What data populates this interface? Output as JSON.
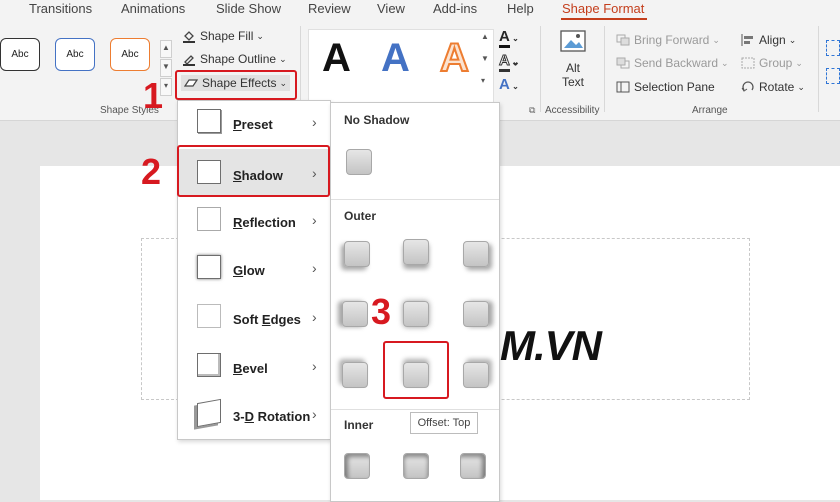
{
  "tabs": [
    "Transitions",
    "Animations",
    "Slide Show",
    "Review",
    "View",
    "Add-ins",
    "Help",
    "Shape Format"
  ],
  "active_tab": "Shape Format",
  "shape_styles": {
    "swatches": [
      "Abc",
      "Abc",
      "Abc"
    ],
    "swatch_colors": [
      "#333333",
      "#4472c4",
      "#ed7d31"
    ],
    "fill_label": "Shape Fill",
    "outline_label": "Shape Outline",
    "effects_label": "Shape Effects",
    "group_label": "Shape Styles"
  },
  "wordart": {
    "letter": "A",
    "colors": [
      "#111111",
      "#4472c4",
      "#ed7d31"
    ]
  },
  "accessibility": {
    "alt_text_line1": "Alt",
    "alt_text_line2": "Text",
    "group_label": "Accessibility"
  },
  "arrange": {
    "bring_forward": "Bring Forward",
    "send_backward": "Send Backward",
    "selection_pane": "Selection Pane",
    "align": "Align",
    "group": "Group",
    "rotate": "Rotate",
    "group_label": "Arrange"
  },
  "callouts": [
    "1",
    "2",
    "3"
  ],
  "effects_menu": [
    {
      "label": "Preset",
      "accel": "P",
      "rest": "reset"
    },
    {
      "label": "Shadow",
      "accel": "S",
      "rest": "hadow"
    },
    {
      "label": "Reflection",
      "accel": "R",
      "rest": "eflection"
    },
    {
      "label": "Glow",
      "accel": "G",
      "rest": "low"
    },
    {
      "label": "Soft Edges",
      "accel": "E",
      "pre": "Soft ",
      "rest": "dges"
    },
    {
      "label": "Bevel",
      "accel": "B",
      "rest": "evel"
    },
    {
      "label": "3-D Rotation",
      "accel": "D",
      "pre": "3-",
      "rest": " Rotation"
    }
  ],
  "shadow_gallery": {
    "no_shadow": "No Shadow",
    "outer": "Outer",
    "inner": "Inner",
    "tooltip": "Offset: Top"
  },
  "slide": {
    "watermark": "M.VN"
  }
}
